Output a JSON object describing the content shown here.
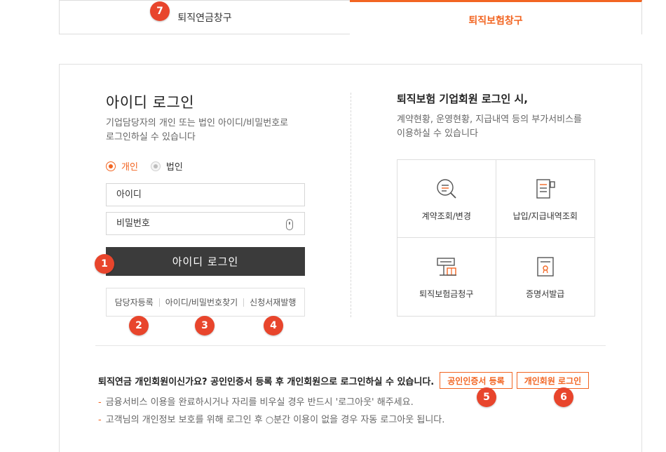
{
  "tabs": {
    "pension": "퇴직연금창구",
    "insurance": "퇴직보험창구"
  },
  "badges": [
    "1",
    "2",
    "3",
    "4",
    "5",
    "6",
    "7"
  ],
  "login": {
    "title": "아이디 로그인",
    "description": "기업담당자의 개인 또는 법인 아이디/비밀번호로\n로그인하실 수 있습니다",
    "radio_personal": "개인",
    "radio_corporate": "법인",
    "id_placeholder": "아이디",
    "pw_placeholder": "비밀번호",
    "button": "아이디 로그인",
    "links": [
      "담당자등록",
      "아이디/비밀번호찾기",
      "신청서재발행"
    ]
  },
  "corporate_info": {
    "title": "퇴직보험 기업회원 로그인 시,",
    "description": "계약현황, 운영현황, 지급내역 등의 부가서비스를\n이용하실 수 있습니다",
    "services": [
      {
        "label": "계약조회/변경",
        "icon": "search-document-icon"
      },
      {
        "label": "납입/지급내역조회",
        "icon": "payment-history-icon"
      },
      {
        "label": "퇴직보험금청구",
        "icon": "claim-terminal-icon"
      },
      {
        "label": "증명서발급",
        "icon": "certificate-icon"
      }
    ]
  },
  "notice": {
    "text": "퇴직연금 개인회원이신가요? 공인인증서 등록 후 개인회원으로 로그인하실 수 있습니다.",
    "cert_button": "공인인증서 등록",
    "personal_login_button": "개인회원 로그인",
    "bullets": [
      "금융서비스 이용을 완료하시거나 자리를 비우실 경우 반드시 '로그아웃' 해주세요.",
      "고객님의 개인정보 보호를 위해 로그인 후 ○분간 이용이 없을 경우 자동 로그아웃 됩니다."
    ]
  },
  "colors": {
    "accent": "#f26522",
    "badge": "#e8452c",
    "button_dark": "#3b3b3b"
  }
}
